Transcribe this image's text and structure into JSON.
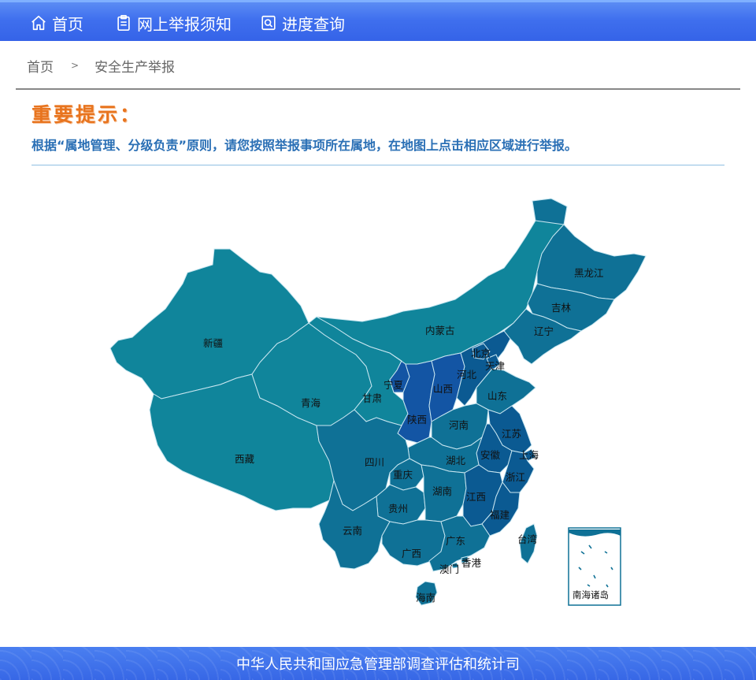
{
  "nav": {
    "items": [
      {
        "label": "首页",
        "icon": "home-icon"
      },
      {
        "label": "网上举报须知",
        "icon": "clipboard-icon"
      },
      {
        "label": "进度查询",
        "icon": "search-document-icon"
      }
    ]
  },
  "breadcrumb": {
    "home": "首页",
    "separator": ">",
    "current": "安全生产举报"
  },
  "notice": {
    "title": "重要提示：",
    "text": "根据“属地管理、分级负责”原则，请您按照举报事项所在属地，在地图上点击相应区域进行举报。"
  },
  "map": {
    "regions": [
      "新疆",
      "西藏",
      "青海",
      "甘肃",
      "内蒙古",
      "宁夏",
      "陕西",
      "山西",
      "河北",
      "北京",
      "天津",
      "山东",
      "河南",
      "江苏",
      "安徽",
      "上海",
      "浙江",
      "湖北",
      "四川",
      "重庆",
      "湖南",
      "江西",
      "福建",
      "贵州",
      "云南",
      "广西",
      "广东",
      "香港",
      "澳门",
      "海南",
      "台湾",
      "黑龙江",
      "吉林",
      "辽宁"
    ],
    "inset_label": "南海诸岛",
    "colors": {
      "light": "#10859b",
      "mid": "#0f7196",
      "deep": "#0b5a92",
      "deepest": "#1355a4",
      "border": "#c8e6f0"
    }
  },
  "footer": {
    "text": "中华人民共和国应急管理部调查评估和统计司"
  }
}
